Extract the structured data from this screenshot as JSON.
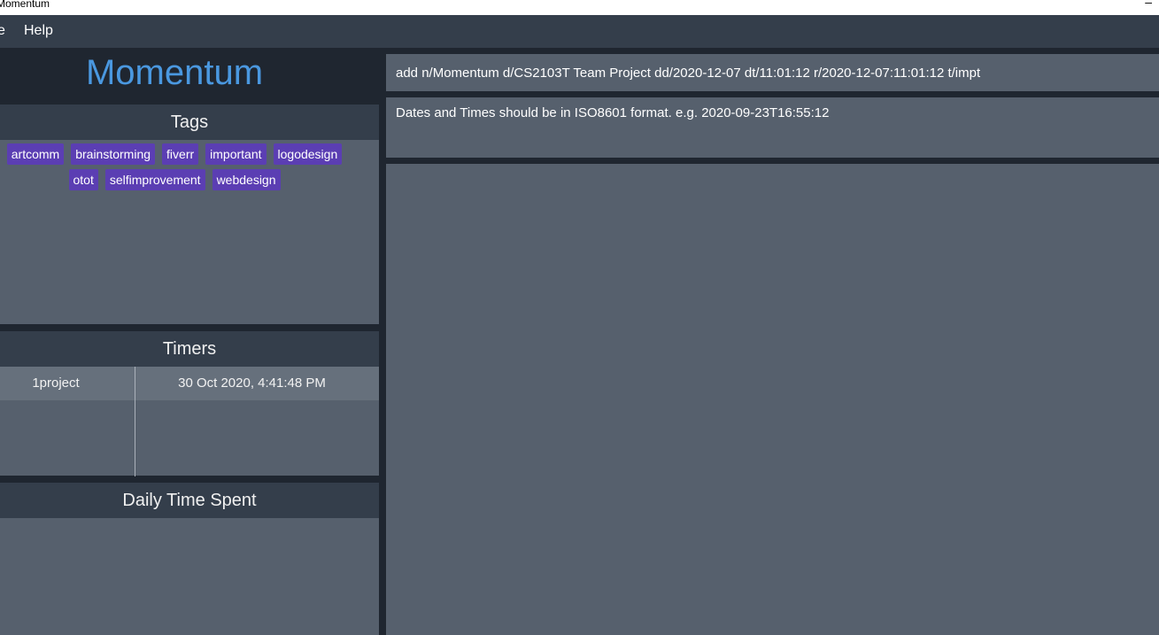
{
  "window": {
    "title": "Momentum",
    "minimize_glyph": "–"
  },
  "menu": {
    "file_label": "e",
    "help_label": "Help"
  },
  "logo": {
    "text": "Momentum",
    "color": "#4a98e0"
  },
  "tags_panel": {
    "title": "Tags",
    "row1": [
      "artcomm",
      "brainstorming",
      "fiverr",
      "important",
      "logodesign"
    ],
    "row2": [
      "otot",
      "selfimprovement",
      "webdesign"
    ],
    "tag_color": "#5b3eb3"
  },
  "timers_panel": {
    "title": "Timers",
    "rows": [
      {
        "name": "1project",
        "started": "30 Oct 2020, 4:41:48 PM"
      }
    ]
  },
  "daily_panel": {
    "title": "Daily Time Spent"
  },
  "command_box": {
    "value": "add n/Momentum d/CS2103T Team Project dd/2020-12-07 dt/11:01:12 r/2020-12-07:11:01:12 t/impt"
  },
  "result_box": {
    "text": "Dates and Times should be in ISO8601 format. e.g. 2020-09-23T16:55:12"
  }
}
